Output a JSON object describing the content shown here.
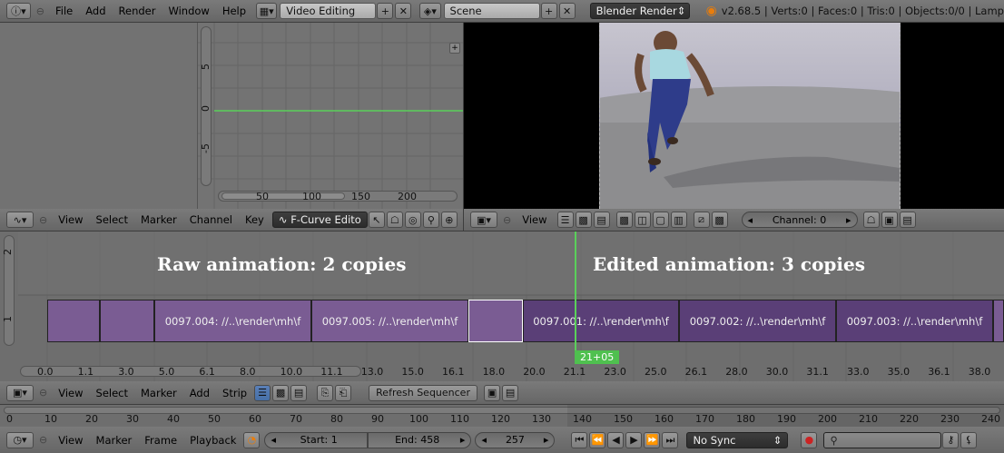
{
  "top": {
    "menus": [
      "File",
      "Add",
      "Render",
      "Window",
      "Help"
    ],
    "layout": "Video Editing",
    "scene": "Scene",
    "engine": "Blender Render",
    "stats": "v2.68.5 | Verts:0 | Faces:0 | Tris:0 | Objects:0/0 | Lamp"
  },
  "graph": {
    "yticks": [
      "5",
      "0",
      "-5"
    ],
    "xticks": [
      "50",
      "100",
      "150",
      "200"
    ]
  },
  "fcurve_header": {
    "menus": [
      "View",
      "Select",
      "Marker",
      "Channel",
      "Key"
    ],
    "mode": "F-Curve Edito"
  },
  "preview_header": {
    "view": "View",
    "channel": "Channel: 0"
  },
  "seq": {
    "label_raw": "Raw animation: 2 copies",
    "label_edited": "Edited animation: 3 copies",
    "frame": "21+05",
    "strips": [
      {
        "label": ""
      },
      {
        "label": ""
      },
      {
        "label": "0097.004: //..\\render\\mh\\f"
      },
      {
        "label": "0097.005: //..\\render\\mh\\f"
      },
      {
        "label": ""
      },
      {
        "label": "0097.001: //..\\render\\mh\\f"
      },
      {
        "label": "0097.002: //..\\render\\mh\\f"
      },
      {
        "label": "0097.003: //..\\render\\mh\\f"
      }
    ],
    "channels": [
      "2",
      "1"
    ],
    "ruler": [
      "0.0",
      "1.1",
      "3.0",
      "5.0",
      "6.1",
      "8.0",
      "10.0",
      "11.1",
      "13.0",
      "15.0",
      "16.1",
      "18.0",
      "20.0",
      "21.1",
      "23.0",
      "25.0",
      "26.1",
      "28.0",
      "30.0",
      "31.1",
      "33.0",
      "35.0",
      "36.1",
      "38.0"
    ]
  },
  "seq_header": {
    "menus": [
      "View",
      "Select",
      "Marker",
      "Add",
      "Strip"
    ],
    "refresh": "Refresh Sequencer"
  },
  "timeline": {
    "ticks": [
      "0",
      "10",
      "20",
      "30",
      "40",
      "50",
      "60",
      "70",
      "80",
      "90",
      "100",
      "110",
      "120",
      "130",
      "140",
      "150",
      "160",
      "170",
      "180",
      "190",
      "200",
      "210",
      "220",
      "230",
      "240"
    ]
  },
  "tl_header": {
    "menus": [
      "View",
      "Marker",
      "Frame",
      "Playback"
    ],
    "start": "Start: 1",
    "end": "End: 458",
    "current": "257",
    "sync": "No Sync"
  }
}
